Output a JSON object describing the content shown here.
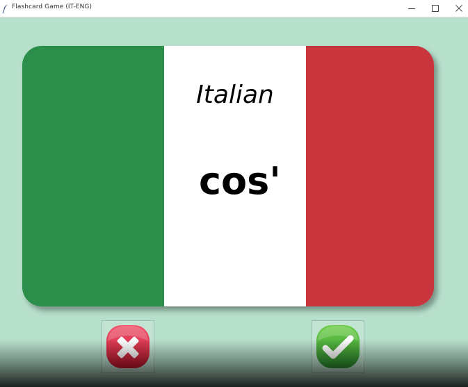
{
  "window": {
    "title": "Flashcard Game (IT-ENG)",
    "min_symbol": "—",
    "max_symbol": "☐",
    "close_symbol": "✕"
  },
  "card": {
    "title": "Italian",
    "word": "cos'",
    "flag_colors": {
      "green": "#2b8f4b",
      "white": "#ffffff",
      "red": "#c8353d"
    }
  },
  "buttons": {
    "wrong": {
      "icon": "cross-icon",
      "color": "#e0304a"
    },
    "right": {
      "icon": "checkmark-icon",
      "color": "#3eaa3a"
    }
  },
  "colors": {
    "background": "#b7e0cc"
  }
}
